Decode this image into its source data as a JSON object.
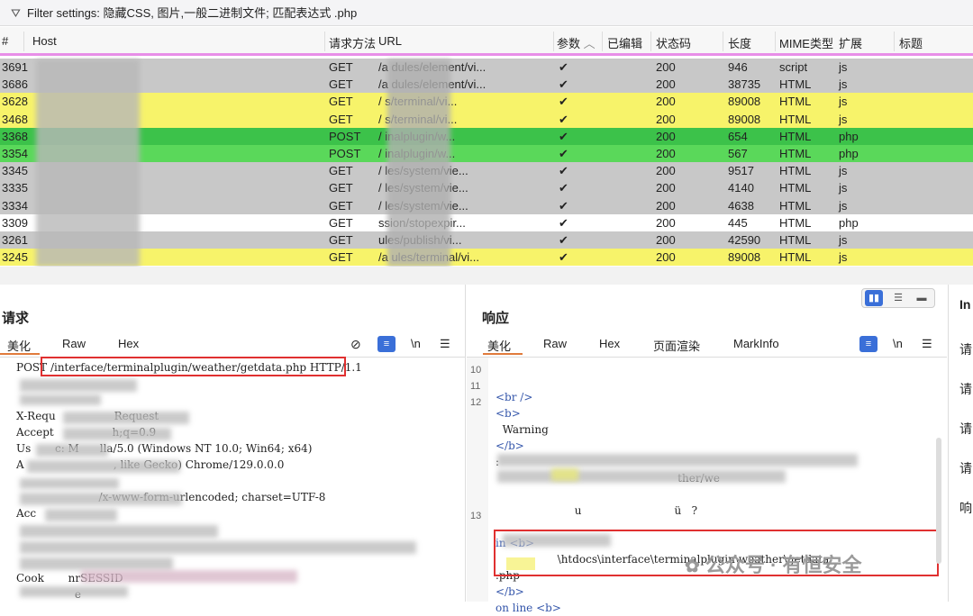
{
  "filter": {
    "icon": "funnel-icon",
    "text": "Filter settings: 隐藏CSS, 图片,一般二进制文件; 匹配表达式 .php"
  },
  "columns": [
    "#",
    "Host",
    "请求方法",
    "URL",
    "参数",
    "已编辑",
    "状态码",
    "长度",
    "MIME类型",
    "扩展",
    "标题"
  ],
  "rows": [
    {
      "id": "3691",
      "method": "GET",
      "url": "/a         dules/element/vi...",
      "param": "✔",
      "status": "200",
      "length": "946",
      "mime": "script",
      "ext": "js",
      "bg": "#c8c8c8"
    },
    {
      "id": "3686",
      "method": "GET",
      "url": "/a         dules/element/vi...",
      "param": "✔",
      "status": "200",
      "length": "38735",
      "mime": "HTML",
      "ext": "js",
      "bg": "#c8c8c8"
    },
    {
      "id": "3628",
      "method": "GET",
      "url": "/               s/terminal/vi...",
      "param": "✔",
      "status": "200",
      "length": "89008",
      "mime": "HTML",
      "ext": "js",
      "bg": "#f7f36a"
    },
    {
      "id": "3468",
      "method": "GET",
      "url": "/               s/terminal/vi...",
      "param": "✔",
      "status": "200",
      "length": "89008",
      "mime": "HTML",
      "ext": "js",
      "bg": "#f7f36a"
    },
    {
      "id": "3368",
      "method": "POST",
      "url": "/               inalplugin/w...",
      "param": "✔",
      "status": "200",
      "length": "654",
      "mime": "HTML",
      "ext": "php",
      "bg": "#3cc24a"
    },
    {
      "id": "3354",
      "method": "POST",
      "url": "/               inalplugin/w...",
      "param": "✔",
      "status": "200",
      "length": "567",
      "mime": "HTML",
      "ext": "php",
      "bg": "#5ad85a"
    },
    {
      "id": "3345",
      "method": "GET",
      "url": "/               les/system/vie...",
      "param": "✔",
      "status": "200",
      "length": "9517",
      "mime": "HTML",
      "ext": "js",
      "bg": "#c8c8c8"
    },
    {
      "id": "3335",
      "method": "GET",
      "url": "/               les/system/vie...",
      "param": "✔",
      "status": "200",
      "length": "4140",
      "mime": "HTML",
      "ext": "js",
      "bg": "#c8c8c8"
    },
    {
      "id": "3334",
      "method": "GET",
      "url": "/               les/system/vie...",
      "param": "✔",
      "status": "200",
      "length": "4638",
      "mime": "HTML",
      "ext": "js",
      "bg": "#c8c8c8"
    },
    {
      "id": "3309",
      "method": "GET",
      "url": "               ssion/stopexpir...",
      "param": "✔",
      "status": "200",
      "length": "445",
      "mime": "HTML",
      "ext": "php",
      "bg": "#ffffff"
    },
    {
      "id": "3261",
      "method": "GET",
      "url": "               ules/publish/vi...",
      "param": "✔",
      "status": "200",
      "length": "42590",
      "mime": "HTML",
      "ext": "js",
      "bg": "#c8c8c8"
    },
    {
      "id": "3245",
      "method": "GET",
      "url": "/a              ules/terminal/vi...",
      "param": "✔",
      "status": "200",
      "length": "89008",
      "mime": "HTML",
      "ext": "js",
      "bg": "#f7f36a"
    }
  ],
  "request": {
    "title": "请求",
    "tabs": [
      "美化",
      "Raw",
      "Hex"
    ],
    "icons": [
      "eye-off-icon",
      "wrap-icon",
      "newline-icon",
      "menu-icon"
    ],
    "newline_label": "\\n",
    "lines": [
      "POST /interface/terminalplugin/weather/getdata.php HTTP/1.1",
      "",
      "",
      "X-Requ                 Request",
      "Accept                 h;q=0.9",
      "Us       c: M      lla/5.0 (Windows NT 10.0; Win64; x64)",
      "A                          , like Gecko) Chrome/129.0.0.0",
      "",
      "                        /x-www-form-urlencoded; charset=UTF-8",
      "Acc",
      "",
      "",
      "",
      "Cook       nrSESSID",
      "                 e"
    ]
  },
  "response": {
    "title": "响应",
    "tabs": [
      "美化",
      "Raw",
      "Hex",
      "页面渲染",
      "MarkInfo"
    ],
    "icons": [
      "wrap-icon",
      "newline-icon",
      "menu-icon"
    ],
    "newline_label": "\\n",
    "line_numbers": [
      "10",
      "11",
      "12",
      "",
      "",
      "",
      "",
      "",
      "",
      "13",
      "",
      ""
    ],
    "lines": [
      "",
      "<br />",
      "<b>",
      "  Warning",
      "</b>",
      ":",
      "                                                     ther/we",
      "",
      "                       u                           ü   ?",
      "",
      "in <b>",
      "                  \\htdocs\\interface\\terminalplugin\\weather\\getdata",
      ".php",
      "</b>",
      "on line <b>"
    ]
  },
  "layout_buttons": [
    "split-columns-icon",
    "split-rows-icon",
    "single-pane-icon"
  ],
  "side": {
    "labels": [
      "In",
      "请",
      "请",
      "请",
      "请",
      "响"
    ]
  },
  "watermark": "公众号 · 有恒安全"
}
